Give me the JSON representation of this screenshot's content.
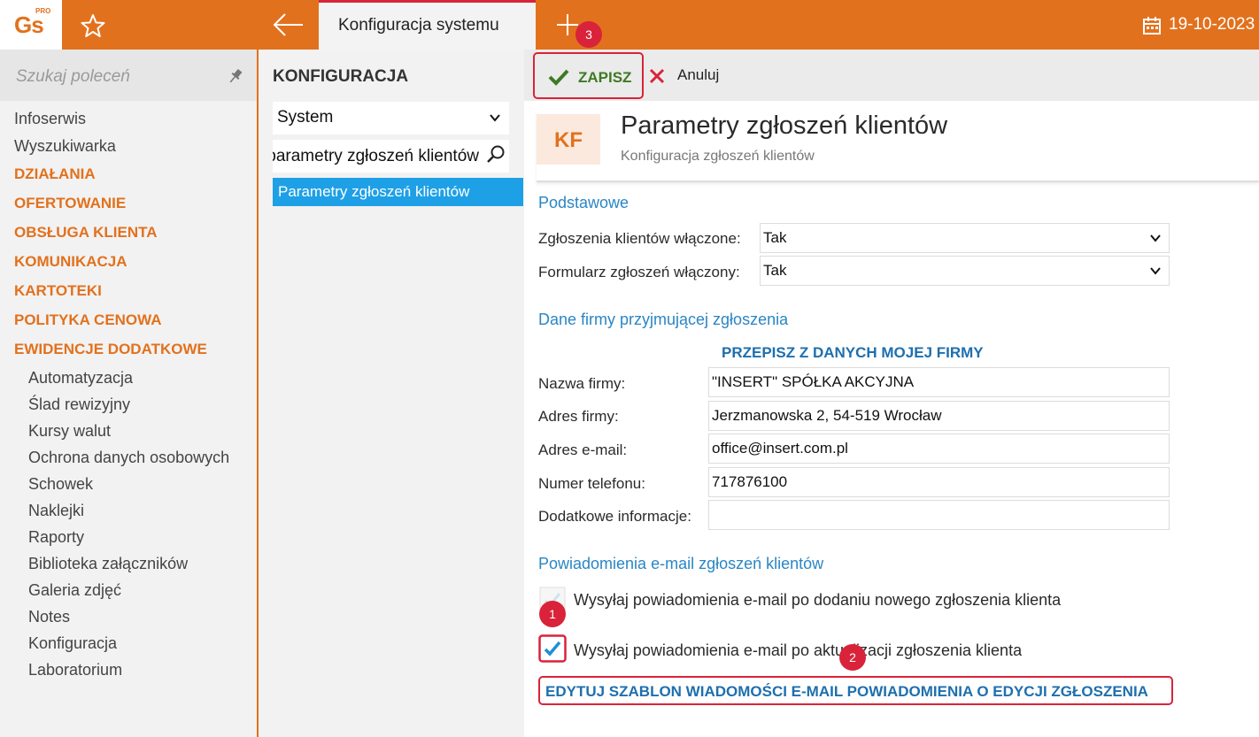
{
  "app": {
    "logo": "Gs",
    "logo_tag": "PRO",
    "active_tab": "Konfiguracja systemu",
    "date": "19-10-2023"
  },
  "sidebar": {
    "search_placeholder": "Szukaj poleceń",
    "items": [
      {
        "label": "Infoserwis",
        "type": "item"
      },
      {
        "label": "Wyszukiwarka",
        "type": "item"
      },
      {
        "label": "DZIAŁANIA",
        "type": "category"
      },
      {
        "label": "OFERTOWANIE",
        "type": "category"
      },
      {
        "label": "OBSŁUGA KLIENTA",
        "type": "category"
      },
      {
        "label": "KOMUNIKACJA",
        "type": "category"
      },
      {
        "label": "KARTOTEKI",
        "type": "category"
      },
      {
        "label": "POLITYKA CENOWA",
        "type": "category"
      },
      {
        "label": "EWIDENCJE DODATKOWE",
        "type": "category"
      },
      {
        "label": "Automatyzacja",
        "type": "sub"
      },
      {
        "label": "Ślad rewizyjny",
        "type": "sub"
      },
      {
        "label": "Kursy walut",
        "type": "sub"
      },
      {
        "label": "Ochrona danych osobowych",
        "type": "sub"
      },
      {
        "label": "Schowek",
        "type": "sub"
      },
      {
        "label": "Naklejki",
        "type": "sub"
      },
      {
        "label": "Raporty",
        "type": "sub"
      },
      {
        "label": "Biblioteka załączników",
        "type": "sub"
      },
      {
        "label": "Galeria zdjęć",
        "type": "sub"
      },
      {
        "label": "Notes",
        "type": "sub"
      },
      {
        "label": "Konfiguracja",
        "type": "sub"
      },
      {
        "label": "Laboratorium",
        "type": "sub"
      }
    ]
  },
  "middle": {
    "title": "KONFIGURACJA",
    "module_select": "System",
    "search_value": "parametry zgłoszeń klientów",
    "result_item": "Parametry zgłoszeń klientów"
  },
  "toolbar": {
    "save_label": "ZAPISZ",
    "cancel_label": "Anuluj"
  },
  "header": {
    "icon_text": "KF",
    "title": "Parametry zgłoszeń klientów",
    "subtitle": "Konfiguracja zgłoszeń klientów"
  },
  "basic": {
    "section": "Podstawowe",
    "requests_enabled_label": "Zgłoszenia klientów włączone:",
    "requests_enabled_value": "Tak",
    "form_enabled_label": "Formularz zgłoszeń włączony:",
    "form_enabled_value": "Tak"
  },
  "company": {
    "section": "Dane firmy przyjmującej zgłoszenia",
    "copy_button": "PRZEPISZ Z DANYCH MOJEJ FIRMY",
    "name_label": "Nazwa firmy:",
    "name_value": "\"INSERT\" SPÓŁKA AKCYJNA",
    "address_label": "Adres firmy:",
    "address_value": "Jerzmanowska 2, 54-519 Wrocław",
    "email_label": "Adres e-mail:",
    "email_value": "office@insert.com.pl",
    "phone_label": "Numer telefonu:",
    "phone_value": "717876100",
    "extra_label": "Dodatkowe informacje:",
    "extra_value": ""
  },
  "notifications": {
    "section": "Powiadomienia e-mail zgłoszeń klientów",
    "on_add_label": "Wysyłaj powiadomienia e-mail po dodaniu nowego zgłoszenia klienta",
    "on_add_checked": false,
    "on_update_label": "Wysyłaj powiadomienia e-mail po aktualizacji zgłoszenia klienta",
    "on_update_checked": true,
    "edit_template_button": "EDYTUJ SZABLON WIADOMOŚCI E-MAIL POWIADOMIENIA O EDYCJI ZGŁOSZENIA"
  },
  "badges": [
    "1",
    "2",
    "3"
  ],
  "colors": {
    "accent": "#e2711d",
    "highlight": "#d9233a",
    "link": "#1e6fae",
    "selection": "#1ea0e6"
  }
}
